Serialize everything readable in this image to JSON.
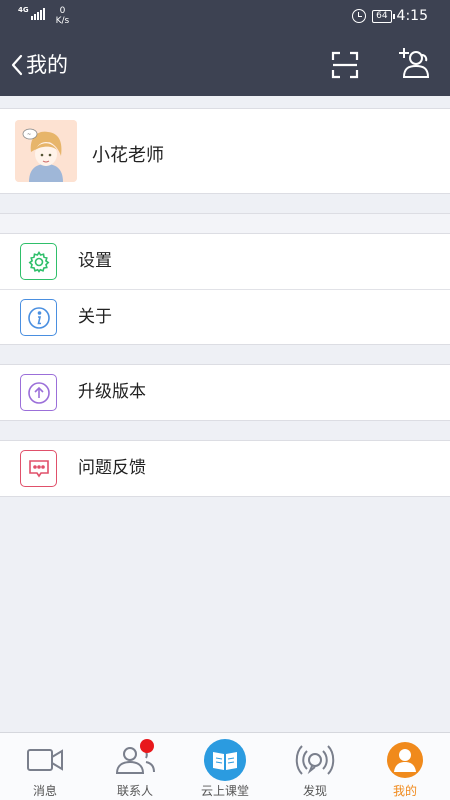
{
  "status_bar": {
    "network": "4G",
    "speed_value": "0",
    "speed_unit": "K/s",
    "battery": "64",
    "time": "4:15"
  },
  "nav": {
    "back_icon": "chevron-left-icon",
    "title": "我的",
    "scan_icon": "scan-icon",
    "add_friend_icon": "add-contact-icon"
  },
  "profile": {
    "name": "小花老师",
    "avatar_icon": "cartoon-girl-avatar"
  },
  "menu": {
    "settings": {
      "label": "设置",
      "icon": "gear-icon",
      "color": "#2fbf6a"
    },
    "about": {
      "label": "关于",
      "icon": "info-icon",
      "color": "#4a8fe0"
    },
    "upgrade": {
      "label": "升级版本",
      "icon": "upload-arrow-icon",
      "color": "#9b6fd9"
    },
    "feedback": {
      "label": "问题反馈",
      "icon": "chat-bubble-icon",
      "color": "#e0506a"
    }
  },
  "tabs": [
    {
      "label": "消息",
      "icon": "video-camera-icon",
      "active": false
    },
    {
      "label": "联系人",
      "icon": "contacts-icon",
      "active": false,
      "badge": true
    },
    {
      "label": "云上课堂",
      "icon": "book-icon",
      "active": false
    },
    {
      "label": "发现",
      "icon": "broadcast-icon",
      "active": false
    },
    {
      "label": "我的",
      "icon": "person-icon",
      "active": true
    }
  ],
  "colors": {
    "header_bg": "#3d4252",
    "active_tab": "#f08a1c",
    "badge": "#e8181c",
    "classroom_blue": "#2b9be0"
  }
}
